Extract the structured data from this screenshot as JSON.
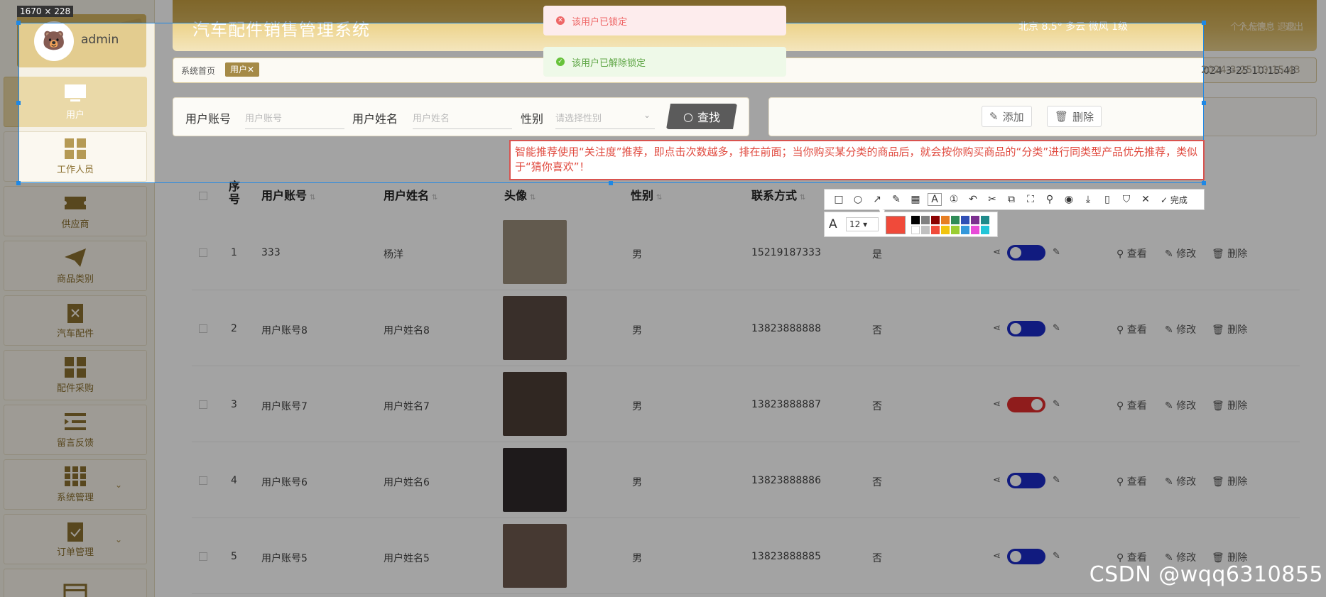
{
  "app": {
    "title": "汽车配件销售管理系统"
  },
  "screenshot_overlay": {
    "size_label": "1670 × 228"
  },
  "header": {
    "weather": "北京  8.5°  多云  微风  1级",
    "links": [
      "个人信息",
      "退出"
    ]
  },
  "user": {
    "name": "admin"
  },
  "sidebar": {
    "items": [
      {
        "label": "用户",
        "icon": "monitor-icon"
      },
      {
        "label": "工作人员",
        "icon": "grid-icon"
      },
      {
        "label": "供应商",
        "icon": "ticket-icon"
      },
      {
        "label": "商品类别",
        "icon": "paper-plane-icon"
      },
      {
        "label": "汽车配件",
        "icon": "clipboard-x-icon"
      },
      {
        "label": "配件采购",
        "icon": "grid-icon"
      },
      {
        "label": "留言反馈",
        "icon": "list-indent-icon"
      },
      {
        "label": "系统管理",
        "icon": "apps-icon"
      },
      {
        "label": "订单管理",
        "icon": "clipboard-check-icon"
      },
      {
        "label": "",
        "icon": "card-icon"
      }
    ]
  },
  "breadcrumb": {
    "home": "系统首页",
    "tab": "用户✕",
    "datetime": "2024-3-25 10:15:43"
  },
  "toasts": {
    "error": "该用户已锁定",
    "success": "该用户已解除锁定"
  },
  "search": {
    "account_label": "用户账号",
    "account_placeholder": "用户账号",
    "name_label": "用户姓名",
    "name_placeholder": "用户姓名",
    "gender_label": "性别",
    "gender_placeholder": "请选择性别",
    "button": "查找"
  },
  "actions": {
    "add": "添加",
    "delete": "删除"
  },
  "note": "智能推荐使用“关注度”推荐，即点击次数越多，排在前面；当你购买某分类的商品后，就会按你购买商品的“分类”进行同类型产品优先推荐，类似于“猜你喜欢”！",
  "table": {
    "headers": [
      "序号",
      "用户账号",
      "用户姓名",
      "头像",
      "性别",
      "联系方式"
    ],
    "ops": {
      "view": "查看",
      "edit": "修改",
      "delete": "删除"
    },
    "rows": [
      {
        "no": "1",
        "account": "333",
        "name": "杨洋",
        "gender": "男",
        "phone": "15219187333",
        "flag": "是",
        "locked": false
      },
      {
        "no": "2",
        "account": "用户账号8",
        "name": "用户姓名8",
        "gender": "男",
        "phone": "13823888888",
        "flag": "否",
        "locked": false
      },
      {
        "no": "3",
        "account": "用户账号7",
        "name": "用户姓名7",
        "gender": "男",
        "phone": "13823888887",
        "flag": "否",
        "locked": true
      },
      {
        "no": "4",
        "account": "用户账号6",
        "name": "用户姓名6",
        "gender": "男",
        "phone": "13823888886",
        "flag": "否",
        "locked": false
      },
      {
        "no": "5",
        "account": "用户账号5",
        "name": "用户姓名5",
        "gender": "男",
        "phone": "13823888885",
        "flag": "否",
        "locked": false
      }
    ]
  },
  "snip_tool": {
    "font_size": "12",
    "done": "完成"
  },
  "watermark": "CSDN @wqq6310855",
  "colors": {
    "accent": "#d4b461",
    "toggle_off": "#1b2bc7",
    "toggle_on": "#e02d2d",
    "note_red": "#e04a3f"
  }
}
